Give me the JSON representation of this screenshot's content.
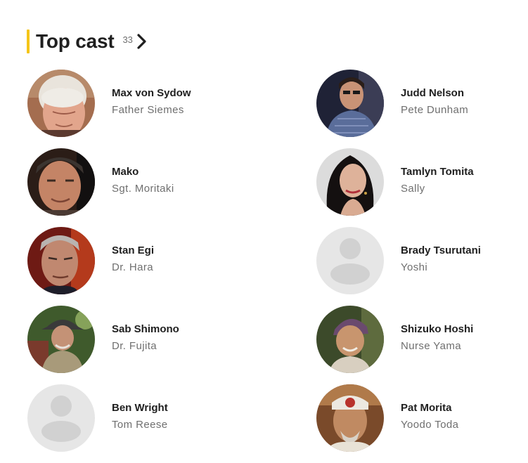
{
  "header": {
    "title": "Top cast",
    "count": "33",
    "accent_color": "#f5c518",
    "arrow_icon": "chevron-right-icon"
  },
  "cast": [
    {
      "name": "Max von Sydow",
      "role": "Father Siemes",
      "photo": "photo"
    },
    {
      "name": "Judd Nelson",
      "role": "Pete Dunham",
      "photo": "photo"
    },
    {
      "name": "Mako",
      "role": "Sgt. Moritaki",
      "photo": "photo"
    },
    {
      "name": "Tamlyn Tomita",
      "role": "Sally",
      "photo": "photo"
    },
    {
      "name": "Stan Egi",
      "role": "Dr. Hara",
      "photo": "photo"
    },
    {
      "name": "Brady Tsurutani",
      "role": "Yoshi",
      "photo": "placeholder-person-icon"
    },
    {
      "name": "Sab Shimono",
      "role": "Dr. Fujita",
      "photo": "photo"
    },
    {
      "name": "Shizuko Hoshi",
      "role": "Nurse Yama",
      "photo": "photo"
    },
    {
      "name": "Ben Wright",
      "role": "Tom Reese",
      "photo": "placeholder-person-icon"
    },
    {
      "name": "Pat Morita",
      "role": "Yoodo Toda",
      "photo": "photo"
    }
  ]
}
